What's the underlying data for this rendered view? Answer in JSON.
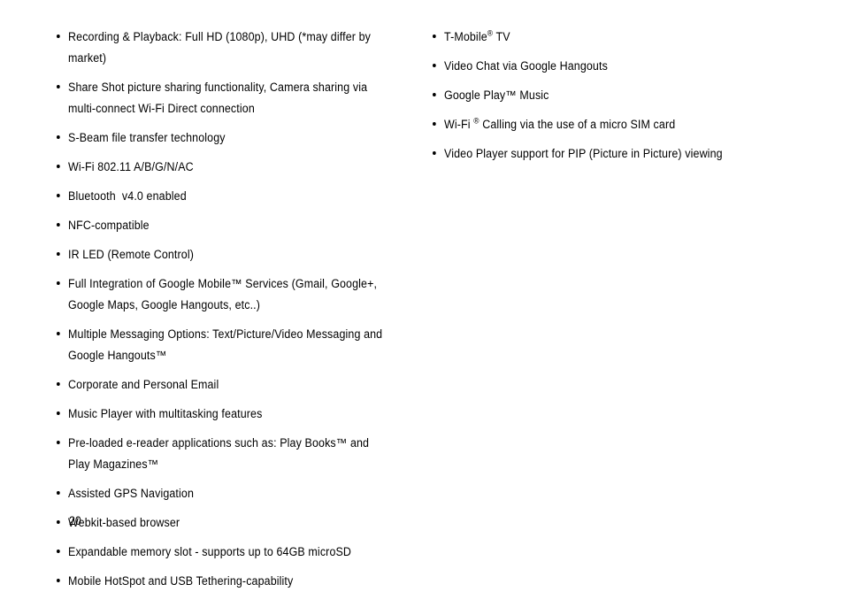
{
  "document": {
    "page_number": "20",
    "background_color": "#ffffff",
    "text_color": "#000000",
    "columns": [
      {
        "id": "left-column",
        "items": [
          {
            "html": "Recording &amp; Playback: Full HD (1080p), UHD (*may differ by market)",
            "text": "Recording & Playback: Full HD (1080p), UHD (*may differ by market)"
          },
          {
            "html": "Share Shot picture sharing functionality, Camera sharing via multi-connect Wi-Fi Direct connection",
            "text": "Share Shot picture sharing functionality, Camera sharing via multi-connect Wi-Fi Direct connection"
          },
          {
            "html": "S-Beam file transfer technology",
            "text": "S-Beam file transfer technology"
          },
          {
            "html": "Wi-Fi 802.11 A/B/G/N/AC",
            "text": "Wi-Fi 802.11 A/B/G/N/AC"
          },
          {
            "html": "Bluetooth&nbsp; v4.0 enabled",
            "text": "Bluetooth  v4.0 enabled"
          },
          {
            "html": "NFC-compatible",
            "text": "NFC-compatible"
          },
          {
            "html": "IR LED (Remote Control)",
            "text": "IR LED (Remote Control)"
          },
          {
            "html": "Full Integration of Google Mobile™ Services (Gmail, Google+, Google Maps, Google Hangouts, etc..)",
            "text": "Full Integration of Google Mobile™ Services (Gmail, Google+, Google Maps, Google Hangouts, etc..)"
          },
          {
            "html": "Multiple Messaging Options: Text/Picture/Video Messaging and Google Hangouts™",
            "text": "Multiple Messaging Options: Text/Picture/Video Messaging and Google Hangouts™"
          },
          {
            "html": "Corporate and Personal Email",
            "text": "Corporate and Personal Email"
          },
          {
            "html": "Music Player with multitasking features",
            "text": "Music Player with multitasking features"
          },
          {
            "html": "Pre-loaded e-reader applications such as: Play Books™ and Play Magazines™",
            "text": "Pre-loaded e-reader applications such as: Play Books™ and Play Magazines™"
          },
          {
            "html": "Assisted GPS Navigation",
            "text": "Assisted GPS Navigation"
          },
          {
            "html": "Webkit-based browser",
            "text": "Webkit-based browser"
          },
          {
            "html": "Expandable memory slot - supports up to 64GB microSD",
            "text": "Expandable memory slot - supports up to 64GB microSD"
          },
          {
            "html": "Mobile HotSpot and USB Tethering-capability",
            "text": "Mobile HotSpot and USB Tethering-capability"
          }
        ]
      },
      {
        "id": "right-column",
        "items": [
          {
            "html": "T-Mobile<sup>®</sup> TV",
            "text": "T-Mobile® TV"
          },
          {
            "html": "Video Chat via Google Hangouts",
            "text": "Video Chat via Google Hangouts"
          },
          {
            "html": "Google Play™ Music",
            "text": "Google Play™ Music"
          },
          {
            "html": "Wi-Fi <sup>®</sup> Calling via the use of a micro SIM card",
            "text": "Wi-Fi ® Calling via the use of a micro SIM card"
          },
          {
            "html": "Video Player support for PIP (Picture in Picture) viewing",
            "text": "Video Player support for PIP (Picture in Picture) viewing"
          }
        ]
      }
    ]
  }
}
